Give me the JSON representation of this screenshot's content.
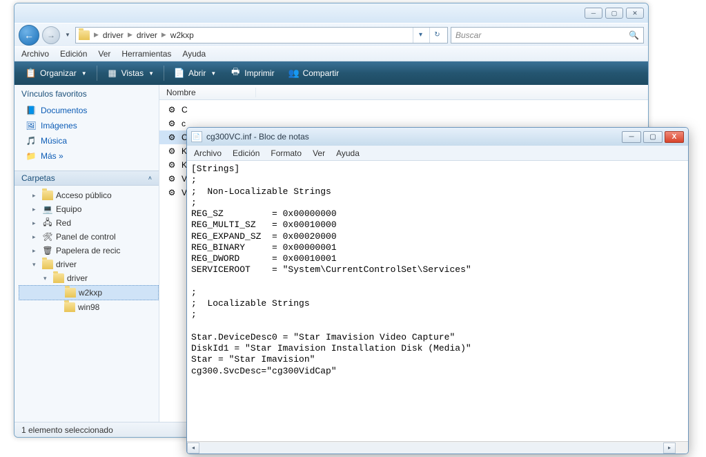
{
  "explorer": {
    "breadcrumbs": [
      "driver",
      "driver",
      "w2kxp"
    ],
    "search_placeholder": "Buscar",
    "menu": [
      "Archivo",
      "Edición",
      "Ver",
      "Herramientas",
      "Ayuda"
    ],
    "toolbar": {
      "organizar": "Organizar",
      "vistas": "Vistas",
      "abrir": "Abrir",
      "imprimir": "Imprimir",
      "compartir": "Compartir"
    },
    "favorites_header": "Vínculos favoritos",
    "favorites": [
      {
        "label": "Documentos",
        "icon": "docs"
      },
      {
        "label": "Imágenes",
        "icon": "pics"
      },
      {
        "label": "Música",
        "icon": "music"
      },
      {
        "label": "Más »",
        "icon": "more"
      }
    ],
    "folders_header": "Carpetas",
    "tree": [
      {
        "label": "Acceso público",
        "icon": "folder",
        "indent": 1
      },
      {
        "label": "Equipo",
        "icon": "computer",
        "indent": 1
      },
      {
        "label": "Red",
        "icon": "network",
        "indent": 1
      },
      {
        "label": "Panel de control",
        "icon": "control",
        "indent": 1
      },
      {
        "label": "Papelera de recic",
        "icon": "recycle",
        "indent": 1
      },
      {
        "label": "driver",
        "icon": "folder",
        "indent": 1,
        "expanded": true
      },
      {
        "label": "driver",
        "icon": "folder",
        "indent": 2,
        "expanded": true
      },
      {
        "label": "w2kxp",
        "icon": "folder",
        "indent": 3,
        "selected": true
      },
      {
        "label": "win98",
        "icon": "folder",
        "indent": 3
      }
    ],
    "columns": [
      "Nombre"
    ],
    "files": [
      {
        "label": "C",
        "icon": "dll"
      },
      {
        "label": "c",
        "icon": "sys"
      },
      {
        "label": "C",
        "icon": "gear",
        "selected": true
      },
      {
        "label": "K",
        "icon": "sys"
      },
      {
        "label": "K",
        "icon": "sys"
      },
      {
        "label": "V",
        "icon": "gear"
      },
      {
        "label": "V",
        "icon": "sys"
      }
    ],
    "status": "1 elemento seleccionado"
  },
  "notepad": {
    "title": "cg300VC.inf - Bloc de notas",
    "menu": [
      "Archivo",
      "Edición",
      "Formato",
      "Ver",
      "Ayuda"
    ],
    "content": "[Strings]\n;\n;  Non-Localizable Strings\n;\nREG_SZ         = 0x00000000\nREG_MULTI_SZ   = 0x00010000\nREG_EXPAND_SZ  = 0x00020000\nREG_BINARY     = 0x00000001\nREG_DWORD      = 0x00010001\nSERVICEROOT    = \"System\\CurrentControlSet\\Services\"\n\n;\n;  Localizable Strings\n;\n\nStar.DeviceDesc0 = \"Star Imavision Video Capture\"\nDiskId1 = \"Star Imavision Installation Disk (Media)\"\nStar = \"Star Imavision\"\ncg300.SvcDesc=\"cg300VidCap\""
  }
}
